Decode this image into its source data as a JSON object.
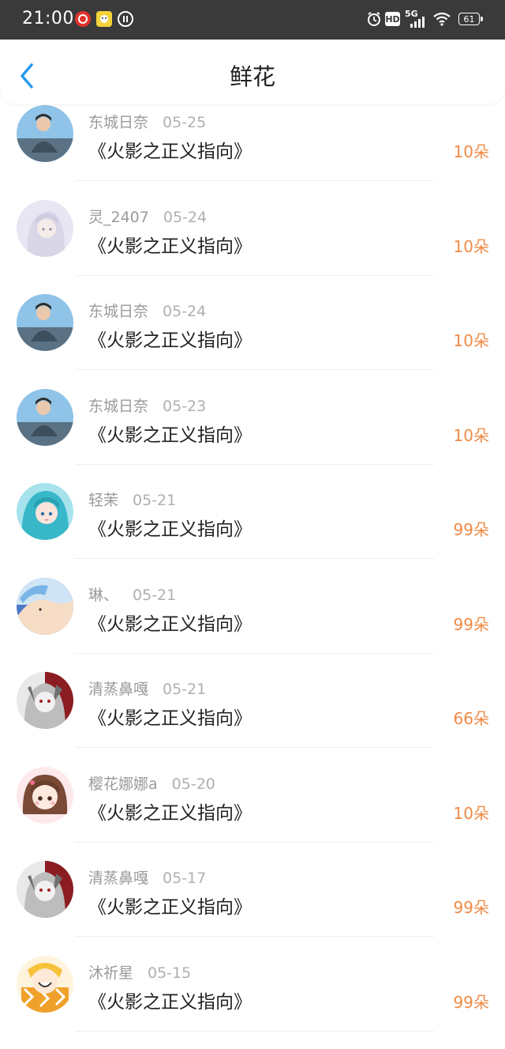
{
  "status_bar": {
    "time": "21:00",
    "network": "5G",
    "hd_badge": "HD",
    "battery": "61"
  },
  "header": {
    "title": "鲜花"
  },
  "flowers": [
    {
      "name": "东城日奈",
      "date": "05-25",
      "book": "《火影之正义指向》",
      "count": "10朵",
      "avatar": "boy"
    },
    {
      "name": "灵_2407",
      "date": "05-24",
      "book": "《火影之正义指向》",
      "count": "10朵",
      "avatar": "white-hair"
    },
    {
      "name": "东城日奈",
      "date": "05-24",
      "book": "《火影之正义指向》",
      "count": "10朵",
      "avatar": "boy"
    },
    {
      "name": "东城日奈",
      "date": "05-23",
      "book": "《火影之正义指向》",
      "count": "10朵",
      "avatar": "boy"
    },
    {
      "name": "轻茉",
      "date": "05-21",
      "book": "《火影之正义指向》",
      "count": "99朵",
      "avatar": "teal-hair"
    },
    {
      "name": "琳、",
      "date": "05-21",
      "book": "《火影之正义指向》",
      "count": "99朵",
      "avatar": "blue-sky"
    },
    {
      "name": "清蒸鼻嘎",
      "date": "05-21",
      "book": "《火影之正义指向》",
      "count": "66朵",
      "avatar": "red-gray"
    },
    {
      "name": "樱花娜娜a",
      "date": "05-20",
      "book": "《火影之正义指向》",
      "count": "10朵",
      "avatar": "chibi-girl"
    },
    {
      "name": "清蒸鼻嘎",
      "date": "05-17",
      "book": "《火影之正义指向》",
      "count": "99朵",
      "avatar": "red-gray"
    },
    {
      "name": "沐祈星",
      "date": "05-15",
      "book": "《火影之正义指向》",
      "count": "99朵",
      "avatar": "orange-chibi"
    }
  ],
  "colors": {
    "accent_blue": "#2a9cf0",
    "count_orange": "#f08a45",
    "status_bar_bg": "#3a3a3a"
  }
}
